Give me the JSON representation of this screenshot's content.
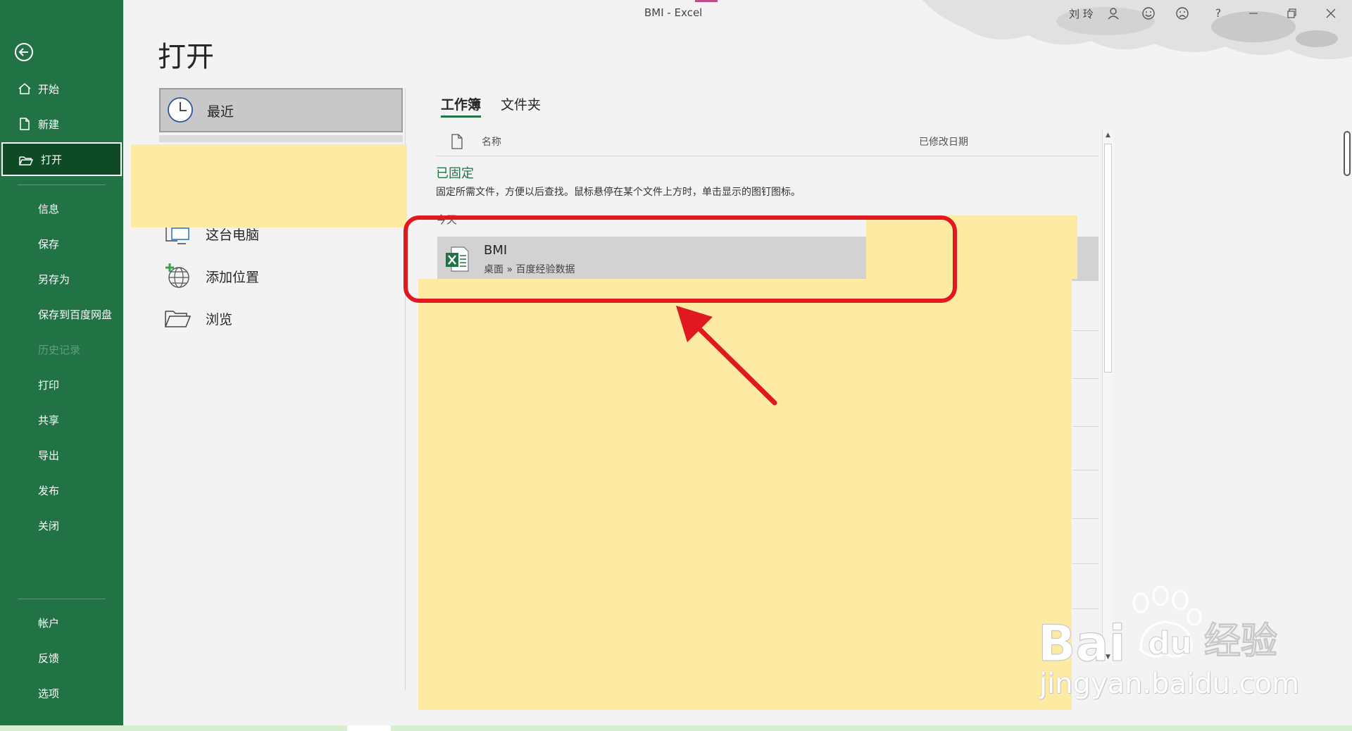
{
  "window": {
    "title": "BMI  -  Excel",
    "user": "刘 玲",
    "icons": [
      "person-icon",
      "smile-icon",
      "frown-icon",
      "help-icon",
      "minimize-icon",
      "restore-icon",
      "close-icon"
    ],
    "help_label": "?"
  },
  "sidebar": {
    "items": [
      {
        "label": "开始",
        "icon": "home-icon"
      },
      {
        "label": "新建",
        "icon": "new-document-icon"
      },
      {
        "label": "打开",
        "icon": "open-folder-icon"
      },
      {
        "label": "信息"
      },
      {
        "label": "保存"
      },
      {
        "label": "另存为"
      },
      {
        "label": "保存到百度网盘"
      },
      {
        "label": "历史记录"
      },
      {
        "label": "打印"
      },
      {
        "label": "共享"
      },
      {
        "label": "导出"
      },
      {
        "label": "发布"
      },
      {
        "label": "关闭"
      },
      {
        "label": "帐户"
      },
      {
        "label": "反馈"
      },
      {
        "label": "选项"
      }
    ],
    "active": "打开",
    "disabled": [
      "历史记录"
    ]
  },
  "page": {
    "title": "打开"
  },
  "locations": {
    "recent": "最近",
    "this_pc": "这台电脑",
    "add_place": "添加位置",
    "browse": "浏览"
  },
  "tabs": {
    "workbooks": "工作簿",
    "folders": "文件夹"
  },
  "file_list": {
    "column_name": "名称",
    "column_modified": "已修改日期",
    "pinned_title": "已固定",
    "pinned_desc": "固定所需文件，方便以后查找。鼠标悬停在某个文件上方时，单击显示的图钉图标。",
    "group_label": "今天",
    "files": [
      {
        "name": "BMI",
        "path": "桌面 » 百度经验数据",
        "icon": "excel-file-icon"
      }
    ]
  },
  "watermark": {
    "logo_text": "Bai du 经验",
    "url": "jingyan.baidu.com"
  },
  "colors": {
    "excel_green": "#217346",
    "active_nav": "#0f4a26",
    "highlight_red": "#e0181f",
    "mask_yellow": "#fdeaa3"
  }
}
